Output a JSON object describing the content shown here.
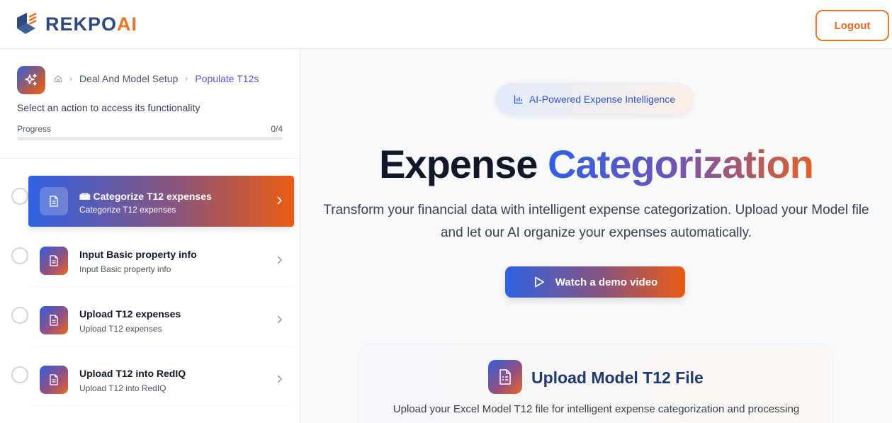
{
  "brand": {
    "name_part1": "REKPO",
    "name_part2": "AI"
  },
  "header": {
    "logout_label": "Logout"
  },
  "sidebar": {
    "breadcrumb": {
      "parent": "Deal And Model Setup",
      "current": "Populate T12s"
    },
    "subtitle": "Select an action to access its functionality",
    "progress": {
      "label": "Progress",
      "count_text": "0/4",
      "completed": 0,
      "total": 4
    },
    "steps": [
      {
        "title": "📾 Categorize T12 expenses",
        "subtitle": "Categorize T12 expenses",
        "active": true
      },
      {
        "title": "Input Basic property info",
        "subtitle": "Input Basic property info",
        "active": false
      },
      {
        "title": "Upload T12 expenses",
        "subtitle": "Upload T12 expenses",
        "active": false
      },
      {
        "title": "Upload T12 into RedIQ",
        "subtitle": "Upload T12 into RedIQ",
        "active": false
      }
    ]
  },
  "main": {
    "pill_label": "AI-Powered Expense Intelligence",
    "title_plain": "Expense",
    "title_gradient": "Categorization",
    "description": "Transform your financial data with intelligent expense categorization. Upload your Model file and let our AI organize your expenses automatically.",
    "demo_button_label": "Watch a demo video",
    "upload_card": {
      "title": "Upload Model T12 File",
      "description": "Upload your Excel Model T12 file for intelligent expense categorization and processing"
    }
  },
  "colors": {
    "brand_blue": "#2f62e3",
    "brand_orange": "#ea5c12",
    "active_breadcrumb": "#6d4ad6"
  },
  "icons": [
    "logo-cube-icon",
    "sparkles-icon",
    "home-icon",
    "document-icon",
    "chevron-right-icon",
    "bar-chart-icon",
    "play-icon",
    "file-spreadsheet-icon"
  ]
}
